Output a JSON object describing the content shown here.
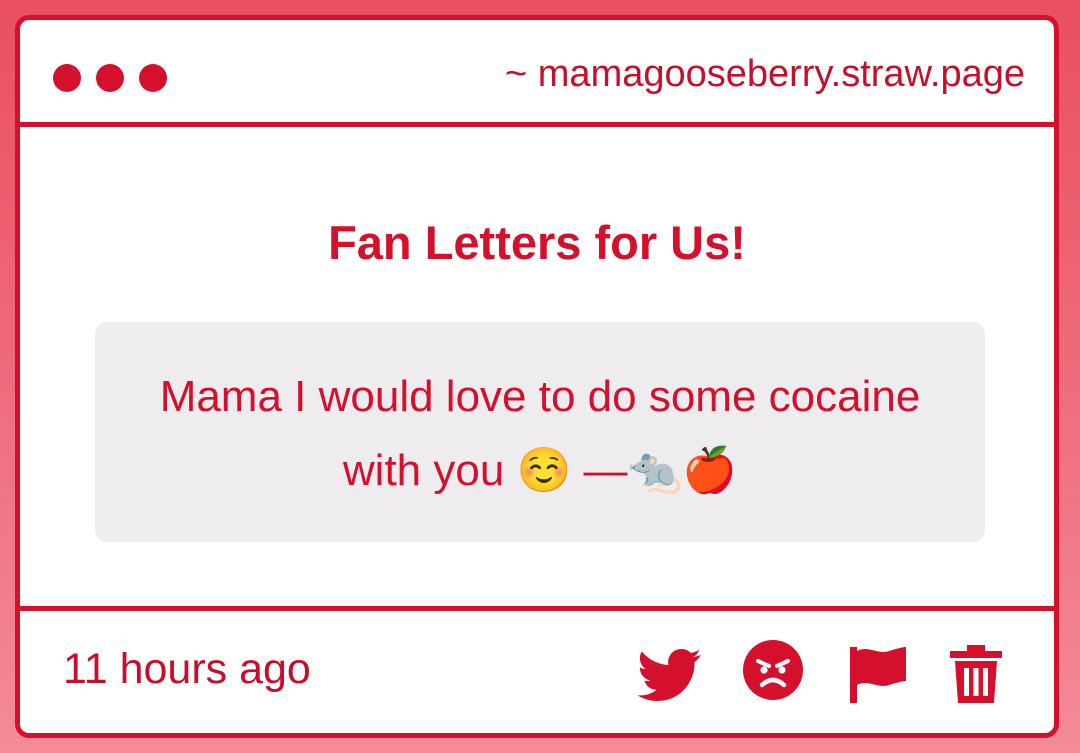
{
  "window": {
    "url": "~ mamagooseberry.straw.page",
    "controls": [
      "close-dot",
      "minimize-dot",
      "maximize-dot"
    ]
  },
  "main": {
    "heading": "Fan Letters for Us!",
    "message": {
      "text": "Mama I would love to do some cocaine with you ☺️ —🐀🍎"
    }
  },
  "footer": {
    "timestamp": "11 hours ago",
    "actions": [
      {
        "icon": "twitter-icon",
        "action": "share-to-twitter"
      },
      {
        "icon": "angry-face-icon",
        "action": "react-angry"
      },
      {
        "icon": "flag-icon",
        "action": "report"
      },
      {
        "icon": "trash-icon",
        "action": "delete"
      }
    ]
  },
  "colors": {
    "accent": "#d4102c",
    "background_top": "#e94f62",
    "background_bottom": "#f48b96",
    "card": "#ffffff",
    "message_box": "#eeecee"
  }
}
